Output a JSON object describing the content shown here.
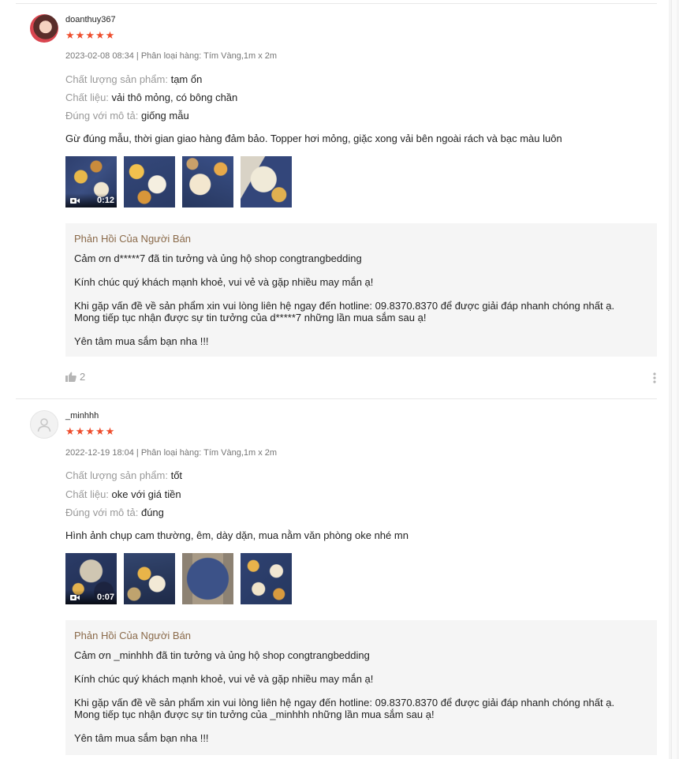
{
  "reviews": [
    {
      "username": "doanthuy367",
      "rating": 5,
      "meta": "2023-02-08 08:34 | Phân loại hàng: Tím Vàng,1m x 2m",
      "attributes": [
        {
          "label": "Chất lượng sản phẩm:",
          "value": "tạm ổn"
        },
        {
          "label": "Chất liệu:",
          "value": "vải thô mỏng, có bông chần"
        },
        {
          "label": "Đúng với mô tả:",
          "value": "giống mẫu"
        }
      ],
      "comment": "Gừ đúng mẫu, thời gian giao hàng đảm bảo. Topper hơi mỏng, giặc xong vải bên ngoài rách và bạc màu luôn",
      "video_duration": "0:12",
      "reply": {
        "title": "Phản Hồi Của Người Bán",
        "lines": [
          "Cảm ơn d*****7 đã tin tưởng và ủng hộ shop congtrangbedding",
          "Kính chúc quý khách mạnh khoẻ, vui vẻ và gặp nhiều may mắn ạ!",
          "Khi gặp vấn đề về sản phẩm xin vui lòng liên hệ ngay đến hotline: 09.8370.8370 để được giải đáp nhanh chóng nhất ạ.",
          "Mong tiếp tục nhận được sự tin tưởng của d*****7 những lần mua sắm sau ạ!",
          "Yên tâm mua sắm bạn nha !!!"
        ]
      },
      "likes": "2"
    },
    {
      "username": "_minhhh",
      "rating": 5,
      "meta": "2022-12-19 18:04 | Phân loại hàng: Tím Vàng,1m x 2m",
      "attributes": [
        {
          "label": "Chất lượng sản phẩm:",
          "value": "tốt"
        },
        {
          "label": "Chất liệu:",
          "value": "oke với giá tiền"
        },
        {
          "label": "Đúng với mô tả:",
          "value": "đúng"
        }
      ],
      "comment": "Hình ảnh chụp cam thường, êm, dày dặn, mua nằm văn phòng oke nhé mn",
      "video_duration": "0:07",
      "reply": {
        "title": "Phản Hồi Của Người Bán",
        "lines": [
          "Cảm ơn _minhhh đã tin tưởng và ủng hộ shop congtrangbedding",
          "Kính chúc quý khách mạnh khoẻ, vui vẻ và gặp nhiều may mắn ạ!",
          "Khi gặp vấn đề về sản phẩm xin vui lòng liên hệ ngay đến hotline: 09.8370.8370 để được giải đáp nhanh chóng nhất ạ.",
          "Mong tiếp tục nhận được sự tin tưởng của _minhhh những lần mua sắm sau ạ!",
          "Yên tâm mua sắm bạn nha !!!"
        ]
      }
    }
  ],
  "colors": {
    "star": "#ee4d2d",
    "reply_title": "#8a6a4a",
    "reply_bg": "#f5f5f5"
  },
  "icons": {
    "star": "star-icon",
    "like": "thumbs-up-icon",
    "more": "more-vertical-icon",
    "video": "video-camera-icon"
  }
}
